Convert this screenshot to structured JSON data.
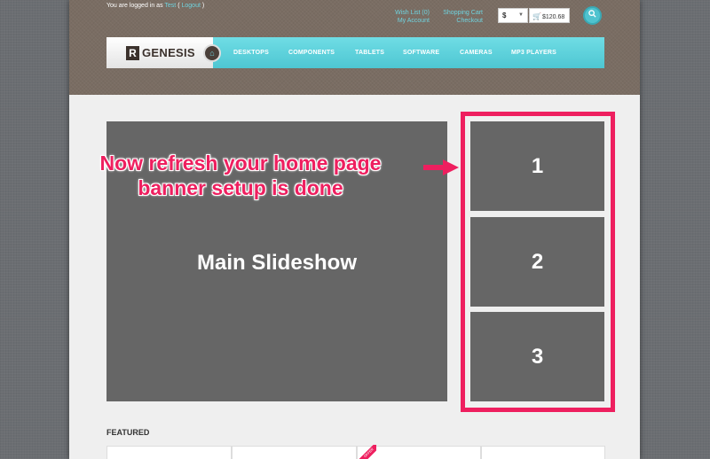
{
  "header": {
    "login_prefix": "You are logged in as",
    "user": "Test",
    "logout_open": "(",
    "logout": "Logout",
    "logout_close": ")",
    "wishlist": "Wish List (0)",
    "my_account": "My Account",
    "shopping_cart": "Shopping Cart",
    "checkout": "Checkout",
    "currency": "$",
    "cart_total": "$120.68"
  },
  "logo": {
    "mark": "R",
    "text": "GENESIS"
  },
  "nav": {
    "items": [
      "DESKTOPS",
      "COMPONENTS",
      "TABLETS",
      "SOFTWARE",
      "CAMERAS",
      "MP3 PLAYERS"
    ]
  },
  "slideshow": {
    "label": "Main Slideshow"
  },
  "banners": [
    "1",
    "2",
    "3"
  ],
  "callout": {
    "line1": "Now refresh your home page",
    "line2": "banner setup is done"
  },
  "featured": {
    "title": "FEATURED",
    "ribbon": "OFFER"
  },
  "colors": {
    "accent": "#ee1f5f",
    "teal": "#4ec6d2",
    "header_brown": "#7a6d63"
  }
}
